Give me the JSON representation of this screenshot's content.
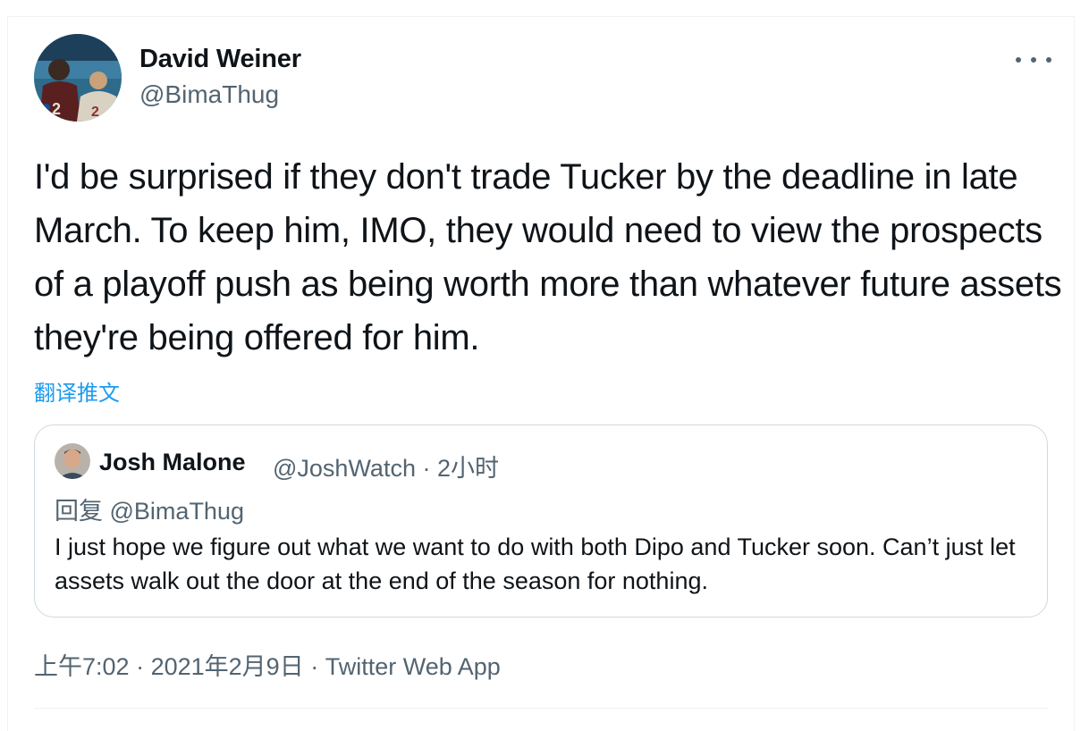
{
  "author": {
    "name": "David Weiner",
    "handle": "@BimaThug",
    "avatar_icon": "profile-photo-icon"
  },
  "tweet": {
    "text": "I'd be surprised if they don't trade Tucker by the deadline in late March. To keep him, IMO, they would need to view the prospects of a playoff push as being worth more than whatever future assets they're being offered for him.",
    "translate_label": "翻译推文"
  },
  "quoted": {
    "name": "Josh Malone",
    "handle": "@JoshWatch",
    "separator": "·",
    "time": "2小时",
    "reply_prefix": "回复",
    "reply_to": "@BimaThug",
    "text": "I just hope we figure out what we want to do with both Dipo and Tucker soon. Can’t just let assets walk out the door at the end of the season for nothing."
  },
  "footer": {
    "time": "上午7:02",
    "sep1": "·",
    "date": "2021年2月9日",
    "sep2": "·",
    "source": "Twitter Web App"
  },
  "colors": {
    "text": "#0f1419",
    "secondary": "#536471",
    "link": "#1d9bf0",
    "border": "#cfd9de"
  },
  "icons": {
    "more": "more-horizontal-icon"
  }
}
